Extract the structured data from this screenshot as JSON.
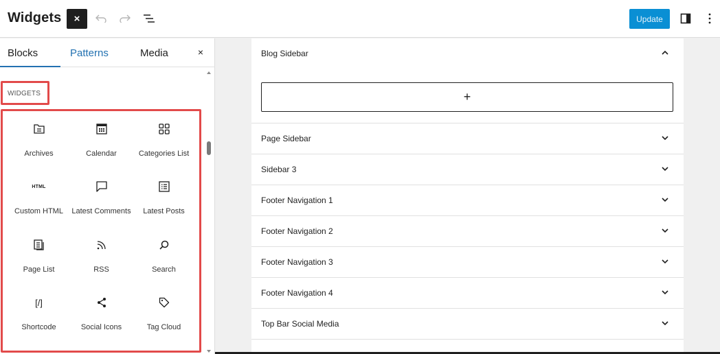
{
  "header": {
    "title": "Widgets",
    "close_label": "×",
    "update_label": "Update"
  },
  "inserter": {
    "tabs": [
      {
        "label": "Blocks",
        "active": true
      },
      {
        "label": "Patterns",
        "active": false
      },
      {
        "label": "Media",
        "active": false
      }
    ],
    "close_label": "×",
    "category": "WIDGETS",
    "blocks": [
      {
        "label": "Archives",
        "icon": "archive-icon"
      },
      {
        "label": "Calendar",
        "icon": "calendar-icon"
      },
      {
        "label": "Categories List",
        "icon": "categories-icon"
      },
      {
        "label": "Custom HTML",
        "icon": "html-icon"
      },
      {
        "label": "Latest Comments",
        "icon": "comment-icon"
      },
      {
        "label": "Latest Posts",
        "icon": "list-icon"
      },
      {
        "label": "Page List",
        "icon": "page-list-icon"
      },
      {
        "label": "RSS",
        "icon": "rss-icon"
      },
      {
        "label": "Search",
        "icon": "search-icon"
      },
      {
        "label": "Shortcode",
        "icon": "shortcode-icon"
      },
      {
        "label": "Social Icons",
        "icon": "share-icon"
      },
      {
        "label": "Tag Cloud",
        "icon": "tag-icon"
      }
    ],
    "html_icon_text": "HTML",
    "shortcode_icon_text": "[/]"
  },
  "widget_areas": [
    {
      "label": "Blog Sidebar",
      "expanded": true
    },
    {
      "label": "Page Sidebar",
      "expanded": false
    },
    {
      "label": "Sidebar 3",
      "expanded": false
    },
    {
      "label": "Footer Navigation 1",
      "expanded": false
    },
    {
      "label": "Footer Navigation 2",
      "expanded": false
    },
    {
      "label": "Footer Navigation 3",
      "expanded": false
    },
    {
      "label": "Footer Navigation 4",
      "expanded": false
    },
    {
      "label": "Top Bar Social Media",
      "expanded": false
    }
  ],
  "add_block_label": "+",
  "colors": {
    "accent": "#2271b1",
    "update_button": "#0a8fd4",
    "highlight": "#e24a4a"
  }
}
